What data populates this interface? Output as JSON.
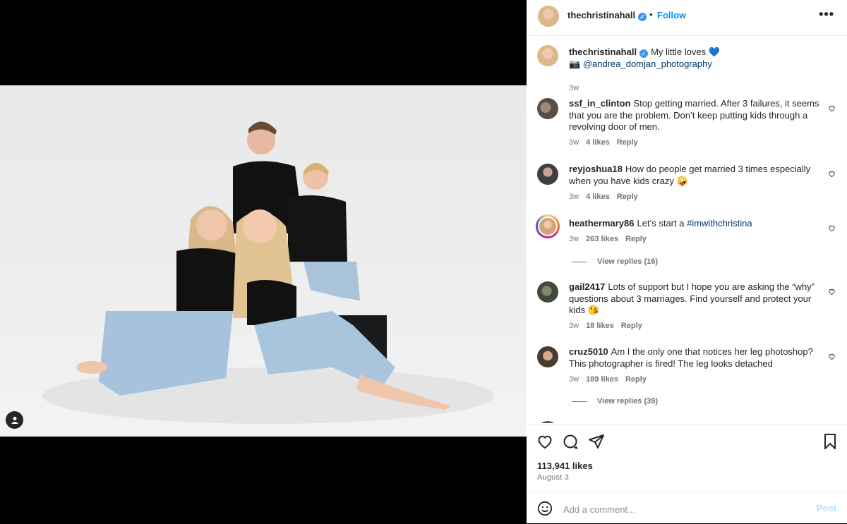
{
  "post": {
    "author": "thechristinahall",
    "follow_label": "Follow",
    "header_separator": "•",
    "verified_mark": "✓",
    "more_label": "•••",
    "caption_main": "My little loves 💙",
    "caption_credit_prefix": "📷",
    "caption_credit_handle": "@andrea_domjan_photography",
    "caption_age": "3w"
  },
  "comments": [
    {
      "user": "ssf_in_clinton",
      "text": "Stop getting married. After 3 failures, it seems that you are the problem. Don’t keep putting kids through a revolving door of men.",
      "age": "3w",
      "likes": "4 likes",
      "reply": "Reply"
    },
    {
      "user": "reyjoshua18",
      "text": "How do people get married 3 times especially when you have kids crazy 🤪",
      "age": "3w",
      "likes": "4 likes",
      "reply": "Reply"
    },
    {
      "user": "heathermary86",
      "text": "Let’s start a ",
      "hashtag": "#imwithchristina",
      "age": "3w",
      "likes": "263 likes",
      "reply": "Reply",
      "view_replies": "View replies (16)"
    },
    {
      "user": "gail2417",
      "text": "Lots of support but I hope you are asking the “why” questions about 3 marriages. Find yourself and protect your kids 😘",
      "age": "3w",
      "likes": "18 likes",
      "reply": "Reply"
    },
    {
      "user": "cruz5010",
      "text": "Am I the only one that notices her leg photoshop? This photographer is fired! The leg looks detached",
      "age": "3w",
      "likes": "189 likes",
      "reply": "Reply",
      "view_replies": "View replies (39)"
    }
  ],
  "stats": {
    "likes": "113,941 likes",
    "date": "August 3"
  },
  "composer": {
    "placeholder": "Add a comment...",
    "post_label": "Post"
  },
  "colors": {
    "accent": "#0095f6",
    "link": "#00376b",
    "muted": "#737373",
    "text": "#262626"
  },
  "icons": [
    "heart-icon",
    "comment-icon",
    "share-icon",
    "bookmark-icon",
    "emoji-icon",
    "more-icon",
    "verified-icon",
    "user-tag-icon"
  ]
}
